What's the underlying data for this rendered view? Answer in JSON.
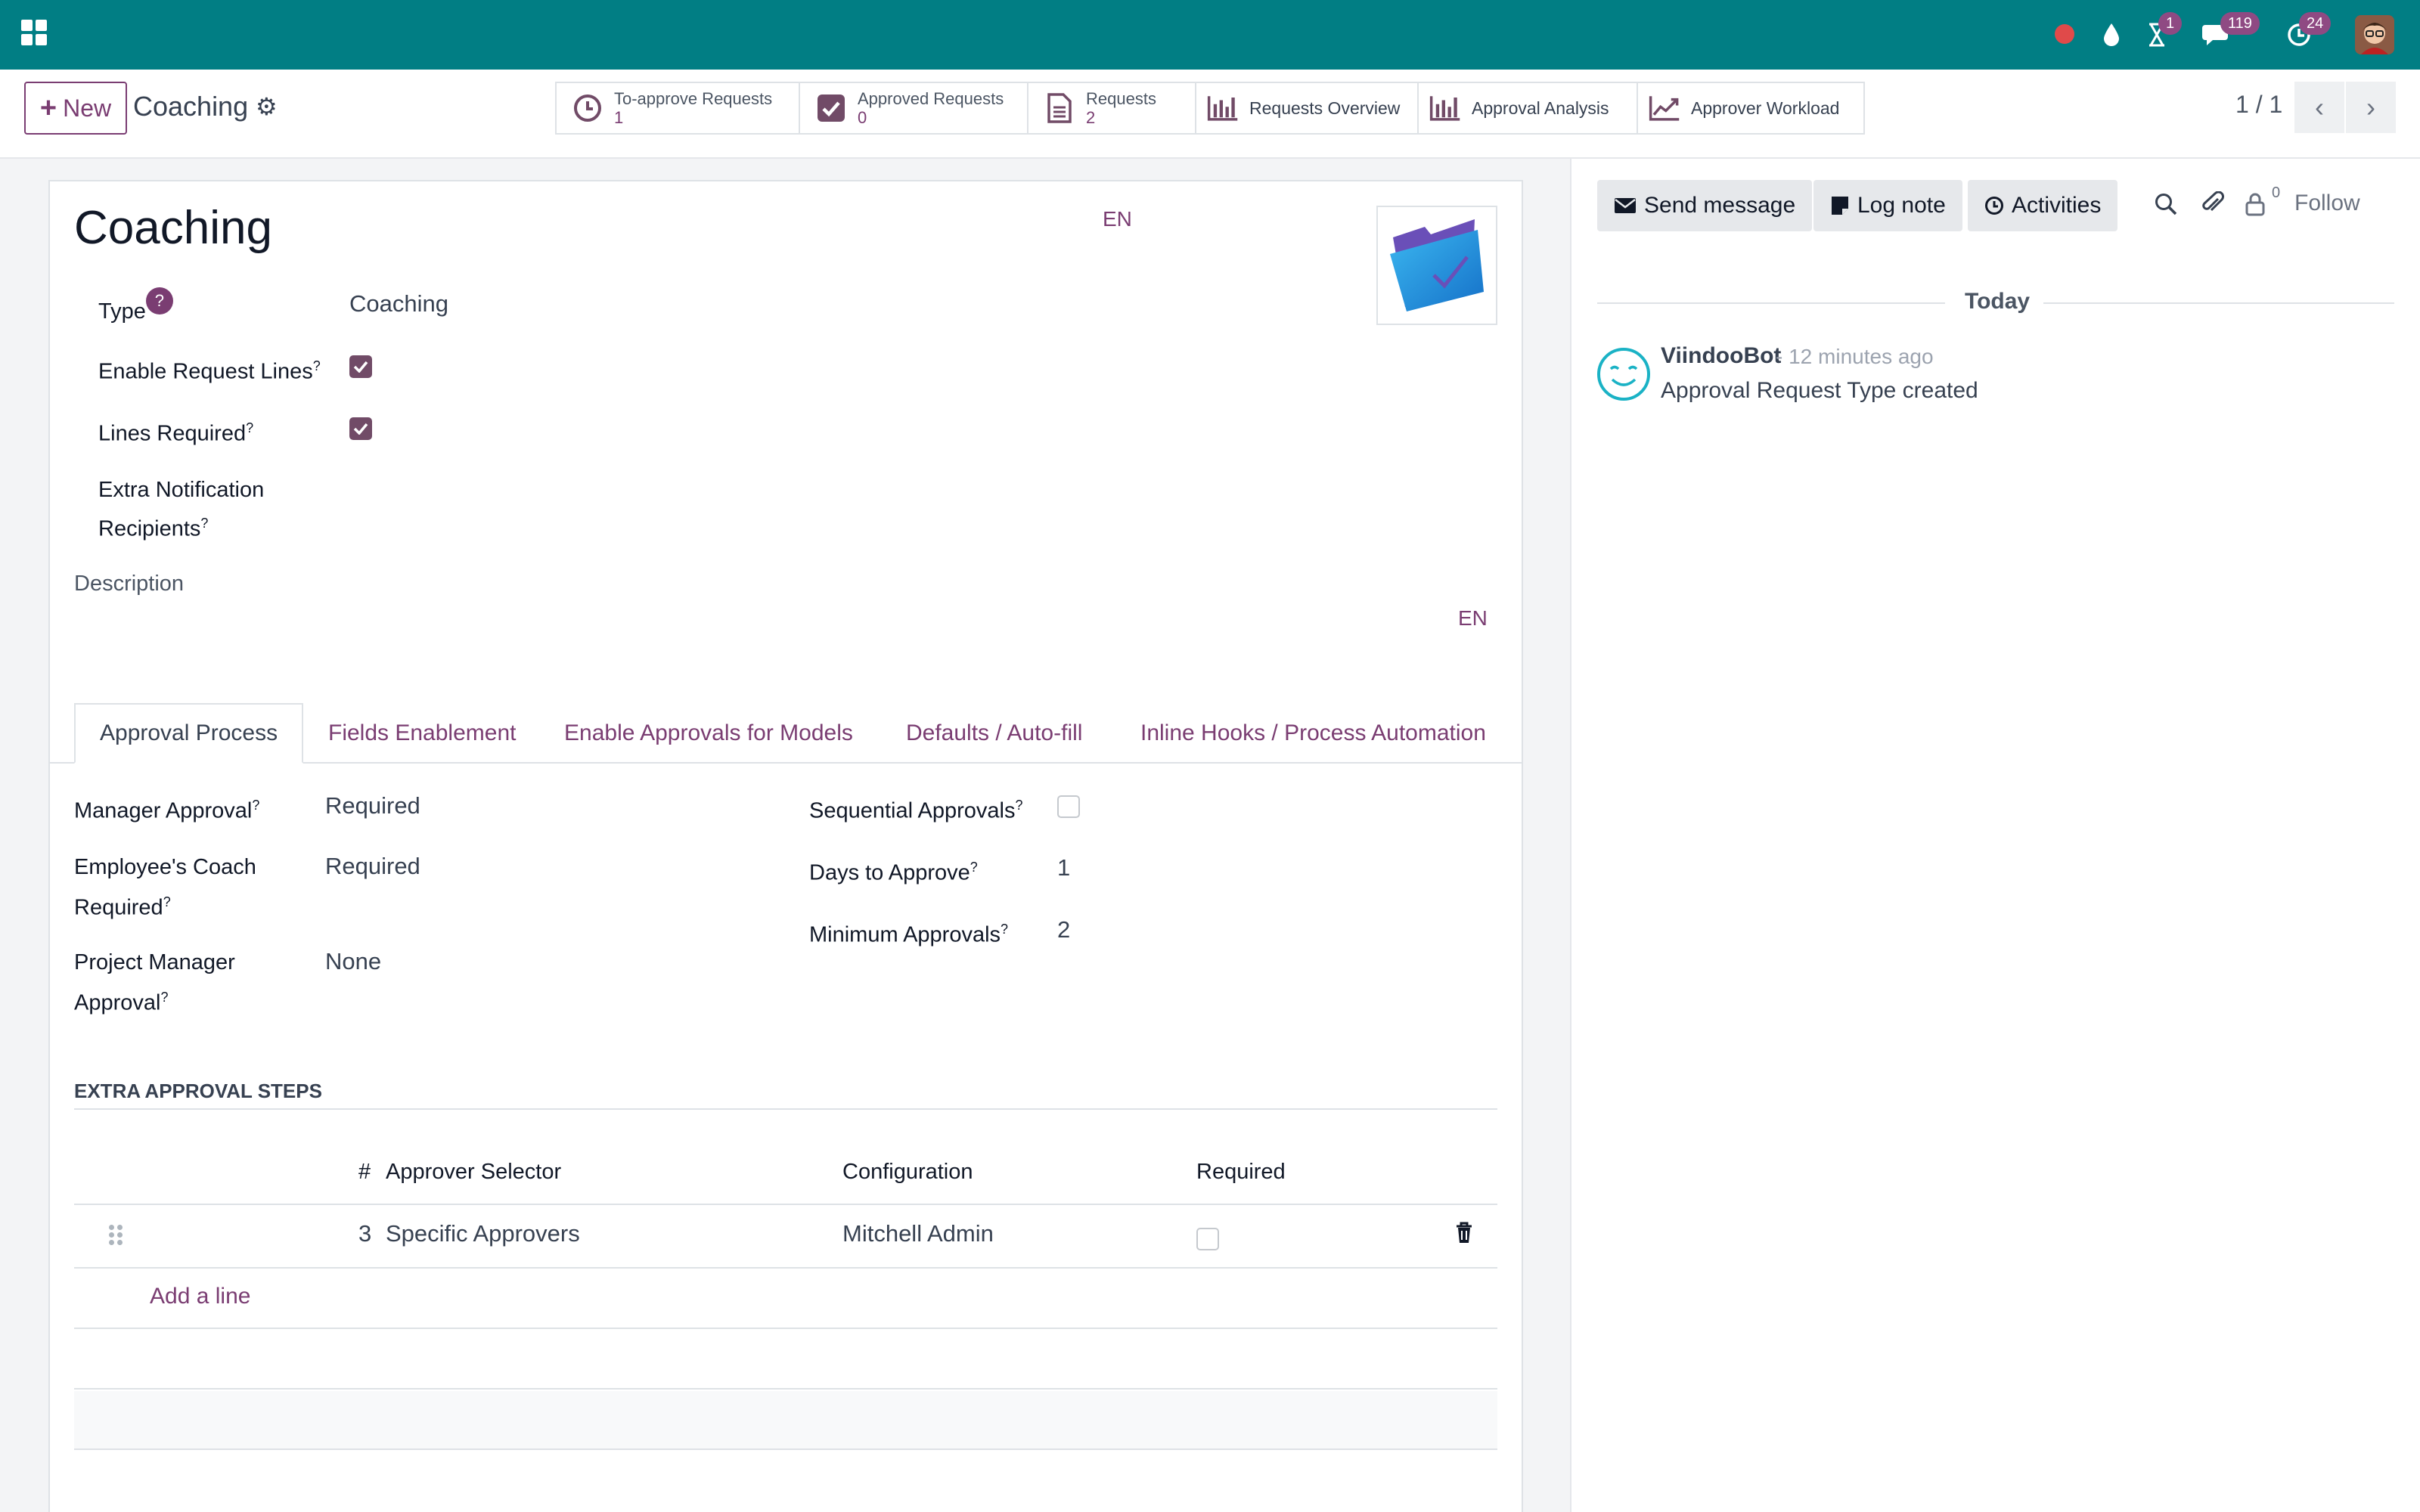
{
  "navbar": {
    "badges": {
      "activities": "1",
      "messages": "119",
      "notifications": "24"
    }
  },
  "control_panel": {
    "new_button": "New",
    "breadcrumb": "Coaching",
    "smart_buttons": [
      {
        "label": "To-approve Requests",
        "value": "1"
      },
      {
        "label": "Approved Requests",
        "value": "0"
      },
      {
        "label": "Requests",
        "value": "2"
      },
      {
        "label": "Requests Overview"
      },
      {
        "label": "Approval Analysis"
      },
      {
        "label": "Approver Workload"
      }
    ],
    "pager": "1 / 1"
  },
  "form": {
    "title": "Coaching",
    "lang": "EN",
    "fields": {
      "type_label": "Type",
      "type_help": "?",
      "type_value": "Coaching",
      "enable_lines_label": "Enable Request Lines",
      "lines_required_label": "Lines Required",
      "extra_recipients_label_1": "Extra Notification",
      "extra_recipients_label_2": "Recipients",
      "description_label": "Description",
      "description_lang": "EN"
    },
    "tabs": [
      "Approval Process",
      "Fields Enablement",
      "Enable Approvals for Models",
      "Defaults / Auto-fill",
      "Inline Hooks / Process Automation"
    ],
    "approval_process": {
      "manager_approval_label": "Manager Approval",
      "manager_approval_value": "Required",
      "coach_label_1": "Employee's Coach",
      "coach_label_2": "Required",
      "coach_value": "Required",
      "pm_label_1": "Project Manager",
      "pm_label_2": "Approval",
      "pm_value": "None",
      "sequential_label": "Sequential Approvals",
      "days_label": "Days to Approve",
      "days_value": "1",
      "min_label": "Minimum Approvals",
      "min_value": "2"
    },
    "extra_steps": {
      "title": "EXTRA APPROVAL STEPS",
      "headers": {
        "num": "#",
        "selector": "Approver Selector",
        "config": "Configuration",
        "required": "Required"
      },
      "rows": [
        {
          "num": "3",
          "selector": "Specific Approvers",
          "config": "Mitchell Admin"
        }
      ],
      "add_line": "Add a line"
    }
  },
  "chatter": {
    "send_message": "Send message",
    "log_note": "Log note",
    "activities": "Activities",
    "followers_count": "0",
    "follow": "Follow",
    "today": "Today",
    "message": {
      "author": "ViindooBot",
      "time": "- 12 minutes ago",
      "body": "Approval Request Type created"
    }
  }
}
